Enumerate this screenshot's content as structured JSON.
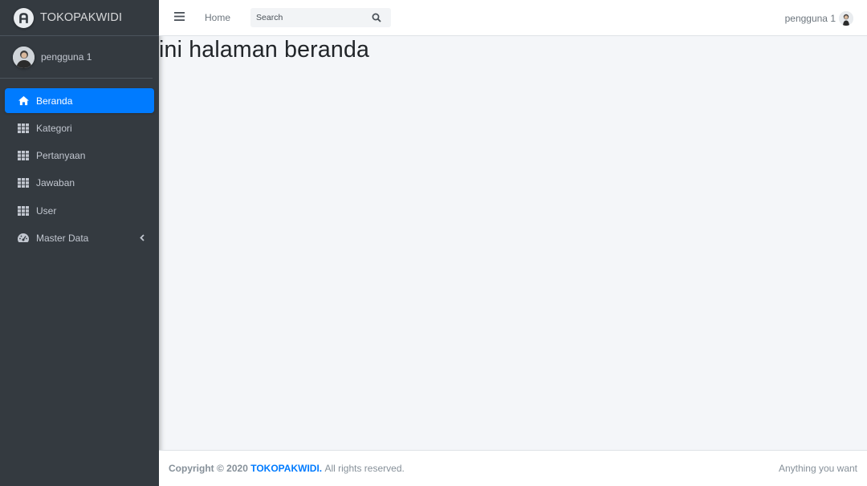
{
  "brand": {
    "name": "TOKOPAKWIDI"
  },
  "sidebar": {
    "user_name": "pengguna 1",
    "items": [
      {
        "label": "Beranda",
        "icon": "home-icon",
        "active": true
      },
      {
        "label": "Kategori",
        "icon": "grid-icon"
      },
      {
        "label": "Pertanyaan",
        "icon": "grid-icon"
      },
      {
        "label": "Jawaban",
        "icon": "grid-icon"
      },
      {
        "label": "User",
        "icon": "grid-icon"
      },
      {
        "label": "Master Data",
        "icon": "dashboard-icon",
        "has_submenu": true
      }
    ]
  },
  "topbar": {
    "home_label": "Home",
    "search_placeholder": "Search",
    "user_name": "pengguna 1"
  },
  "content": {
    "title": "ini halaman beranda"
  },
  "footer": {
    "copyright_prefix": "Copyright © 2020",
    "brand_link": "TOKOPAKWIDI.",
    "rights": "All rights reserved.",
    "right_text": "Anything you want"
  },
  "colors": {
    "sidebar_bg": "#343a40",
    "accent": "#007bff",
    "content_bg": "#f4f6f9"
  }
}
